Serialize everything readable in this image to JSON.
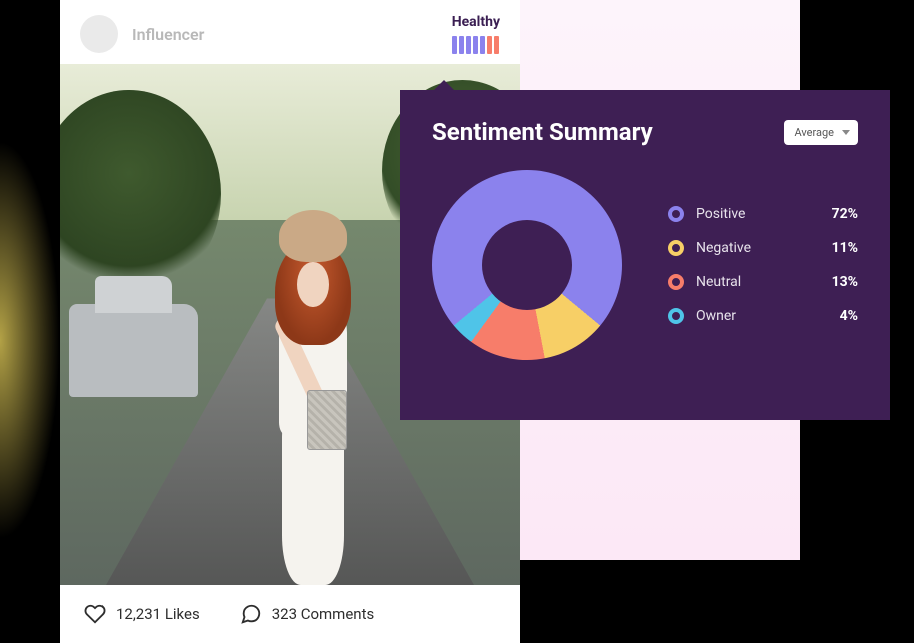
{
  "post": {
    "username": "Influencer",
    "health_label": "Healthy",
    "likes_text": "12,231 Likes",
    "comments_text": "323 Comments"
  },
  "sentiment": {
    "title": "Sentiment Summary",
    "dropdown_selected": "Average",
    "items": [
      {
        "label": "Positive",
        "value_text": "72%",
        "color": "#8b82ed"
      },
      {
        "label": "Negative",
        "value_text": "11%",
        "color": "#f7cf66"
      },
      {
        "label": "Neutral",
        "value_text": "13%",
        "color": "#f77d6a"
      },
      {
        "label": "Owner",
        "value_text": "4%",
        "color": "#4fc4e8"
      }
    ]
  },
  "chart_data": {
    "type": "pie",
    "title": "Sentiment Summary",
    "series": [
      {
        "name": "Positive",
        "value": 72,
        "color": "#8b82ed"
      },
      {
        "name": "Negative",
        "value": 11,
        "color": "#f7cf66"
      },
      {
        "name": "Neutral",
        "value": 13,
        "color": "#f77d6a"
      },
      {
        "name": "Owner",
        "value": 4,
        "color": "#4fc4e8"
      }
    ]
  }
}
